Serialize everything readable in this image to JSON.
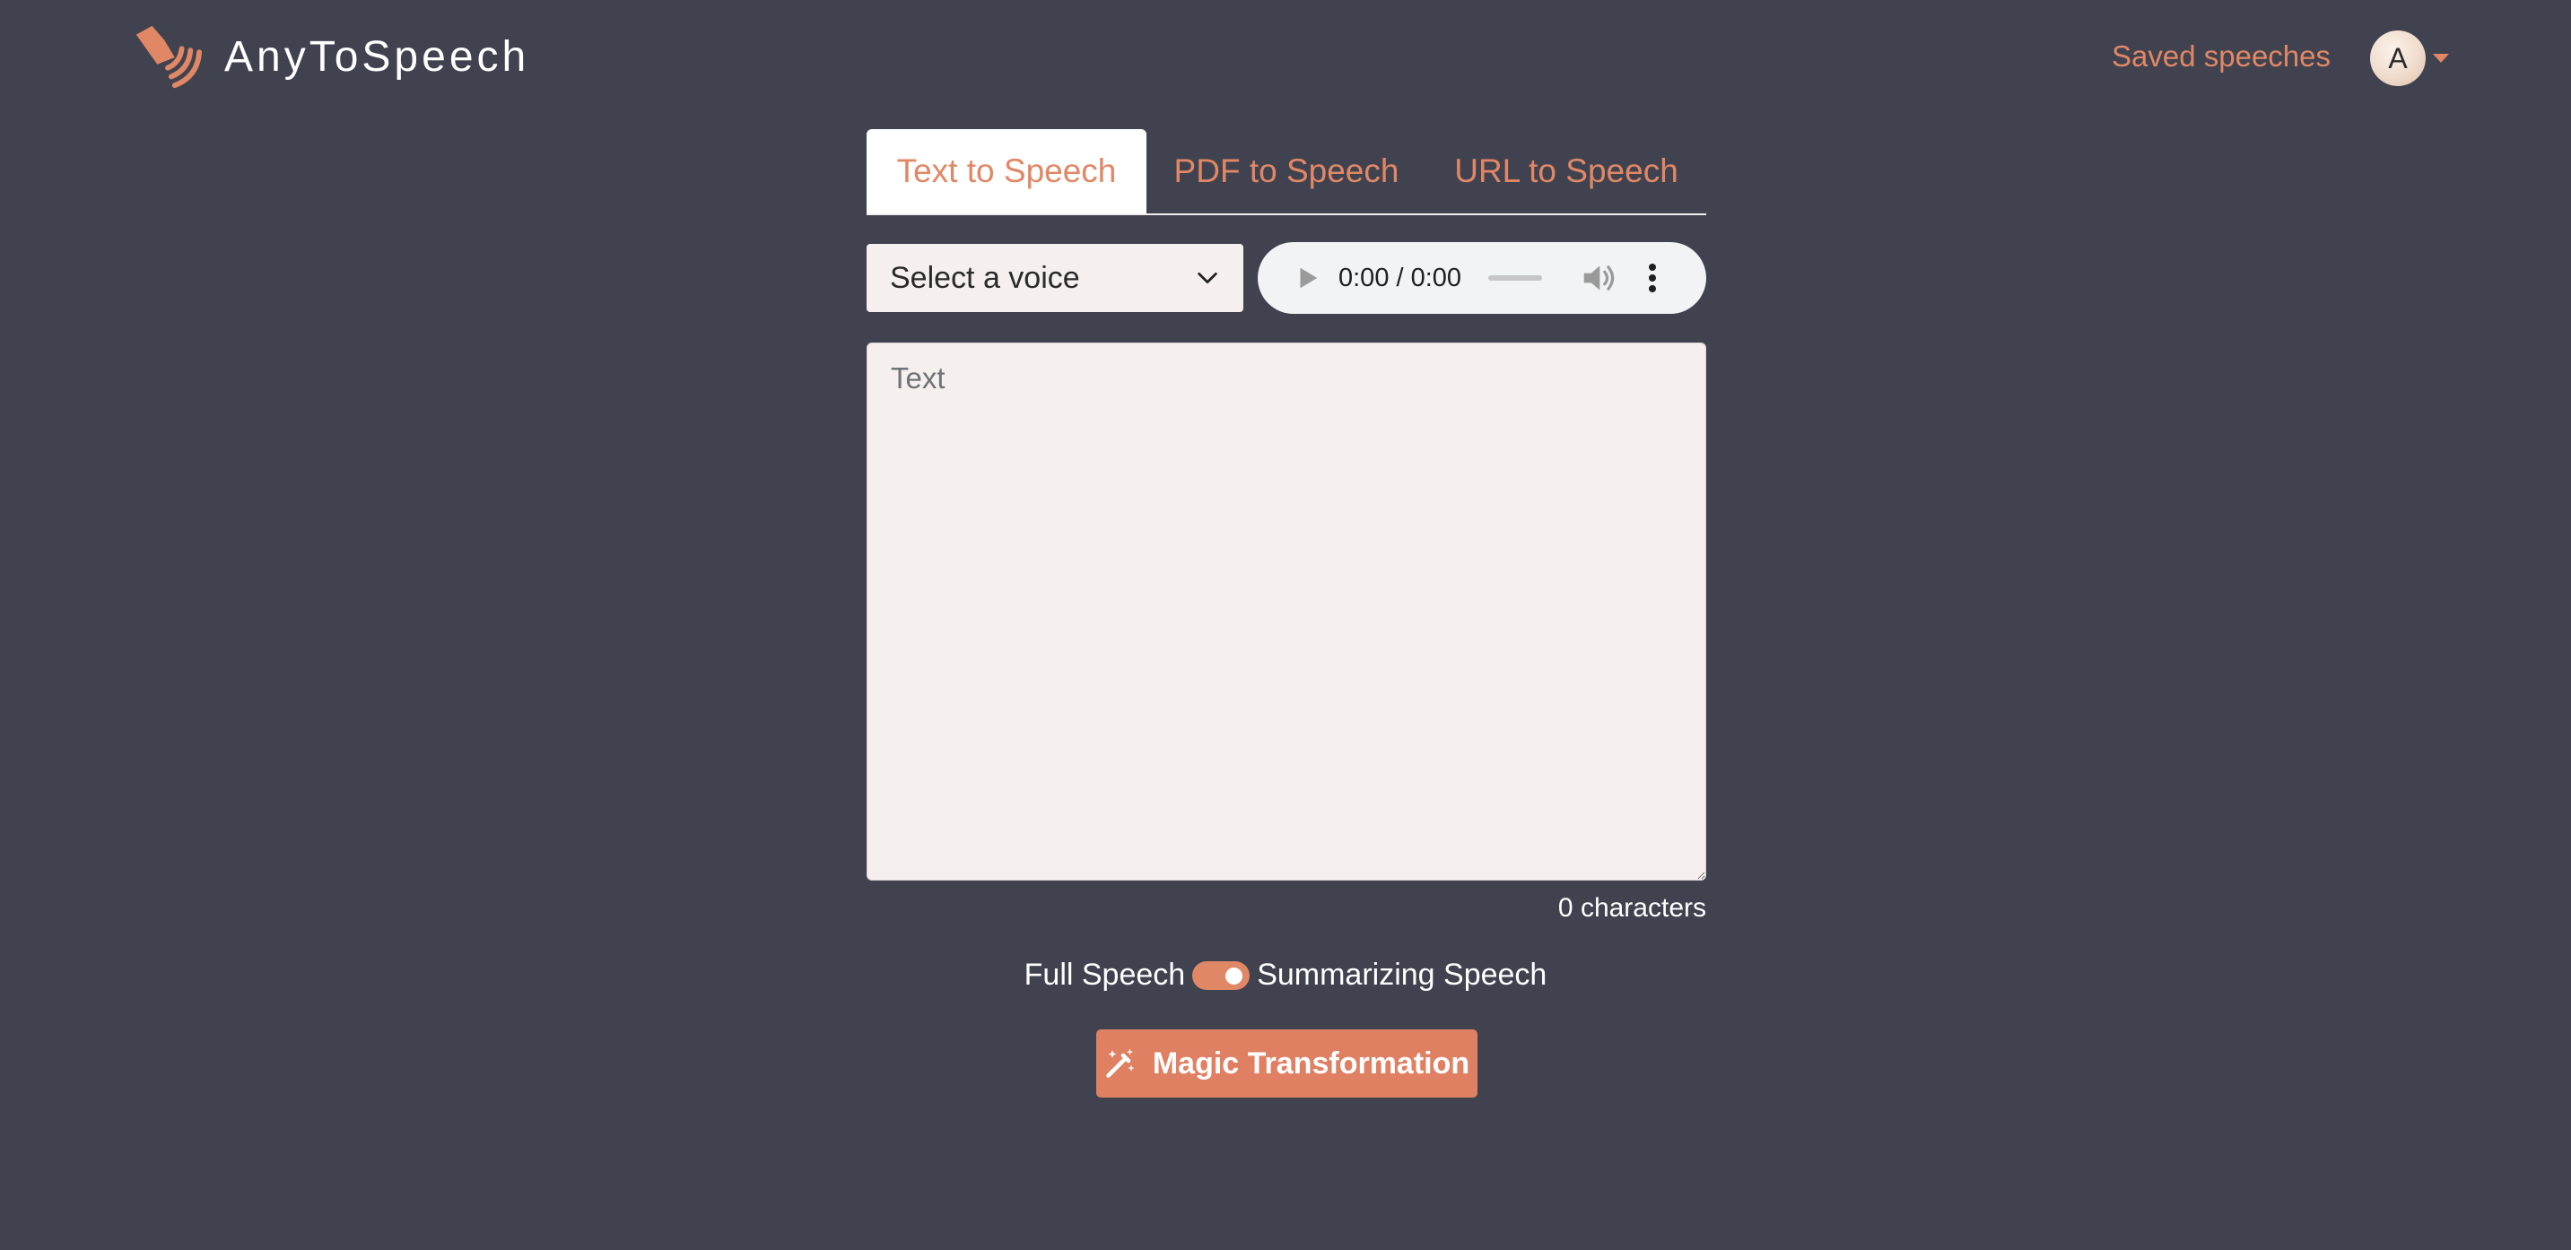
{
  "header": {
    "brand_name": "AnyToSpeech",
    "saved_link": "Saved speeches",
    "avatar_initial": "A"
  },
  "tabs": [
    {
      "label": "Text to Speech",
      "active": true
    },
    {
      "label": "PDF to Speech",
      "active": false
    },
    {
      "label": "URL to Speech",
      "active": false
    }
  ],
  "controls": {
    "voice_select_label": "Select a voice",
    "audio_time": "0:00 / 0:00"
  },
  "editor": {
    "placeholder": "Text",
    "value": "",
    "char_count": "0 characters"
  },
  "mode": {
    "left_label": "Full Speech",
    "right_label": "Summarizing Speech",
    "summarizing_enabled": true
  },
  "action": {
    "button_label": "Magic Transformation"
  },
  "colors": {
    "background": "#40434f",
    "accent": "#e08766",
    "input_bg": "#f5f0ed",
    "text_light": "#ffffff"
  },
  "icons": {
    "logo": "speaker-logo-icon",
    "caret": "caret-down-icon",
    "select_chevron": "chevron-down-icon",
    "play": "play-icon",
    "volume": "volume-icon",
    "more": "more-vertical-icon",
    "wand": "magic-wand-icon"
  }
}
